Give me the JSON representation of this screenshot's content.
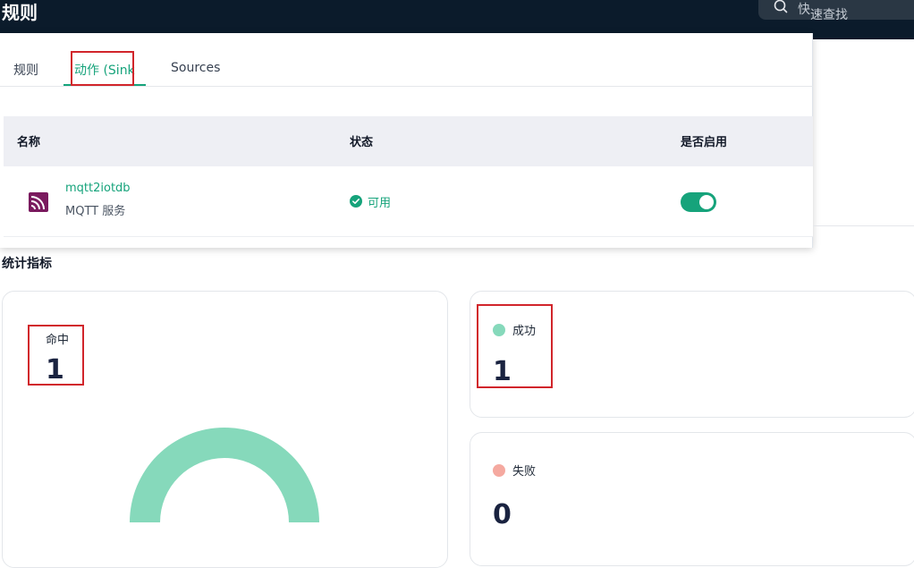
{
  "header": {
    "title": "规则",
    "search_text_a": "快",
    "search_text_b": "速查找"
  },
  "tabs": [
    {
      "label": "规则"
    },
    {
      "label": "动作 (Sink"
    },
    {
      "label": "Sources"
    }
  ],
  "table": {
    "columns": [
      "名称",
      "状态",
      "是否启用"
    ],
    "rows": [
      {
        "name": "mqtt2iotdb",
        "type": "MQTT 服务",
        "status": "可用",
        "enabled": true
      }
    ]
  },
  "metrics": {
    "section_title": "统计指标",
    "hit": {
      "label": "命中",
      "value": "1"
    },
    "success": {
      "label": "成功",
      "value": "1"
    },
    "fail": {
      "label": "失败",
      "value": "0"
    }
  },
  "colors": {
    "accent": "#16a37b",
    "success_dot": "#86d9bb",
    "fail_dot": "#f5a9a0",
    "gauge": "#86d9bb",
    "sink_icon": "#7a1a5e",
    "highlight_box": "#d1252b"
  }
}
